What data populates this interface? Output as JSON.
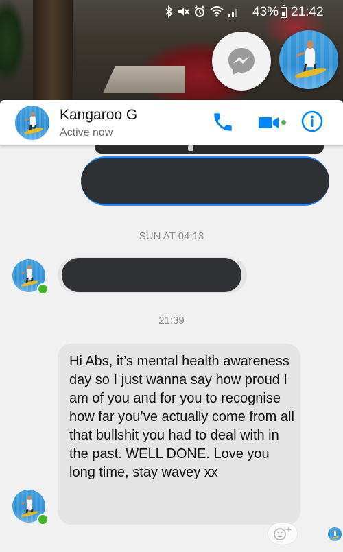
{
  "status_bar": {
    "battery": "43%",
    "time": "21:42",
    "icons": [
      "bluetooth-icon",
      "mute-icon",
      "alarm-icon",
      "wifi-icon",
      "signal-icon",
      "battery-icon"
    ]
  },
  "chat_heads": {
    "messenger_icon": "messenger-logo-icon",
    "contact_avatar": "contact-avatar"
  },
  "header": {
    "contact_name": "Kangaroo G",
    "status": "Active now",
    "actions": [
      "phone-icon",
      "video-camera-icon",
      "info-icon"
    ],
    "accent_color": "#0084ff"
  },
  "messages": {
    "timestamp_1": "SUN AT 04:13",
    "timestamp_2": "21:39",
    "incoming_text": "Hi Abs, it’s mental health awareness day so I just wanna say how proud I am of you and for you to recognise how far you’ve actually come from all that bullshit you had to deal with in the past. WELL DONE. Love you long time, stay wavey xx",
    "outgoing_bubble_color": "#1e86f5",
    "incoming_bubble_color": "#e4e4e4",
    "online_color": "#42b72a"
  },
  "reaction": {
    "icon": "add-reaction-icon"
  }
}
